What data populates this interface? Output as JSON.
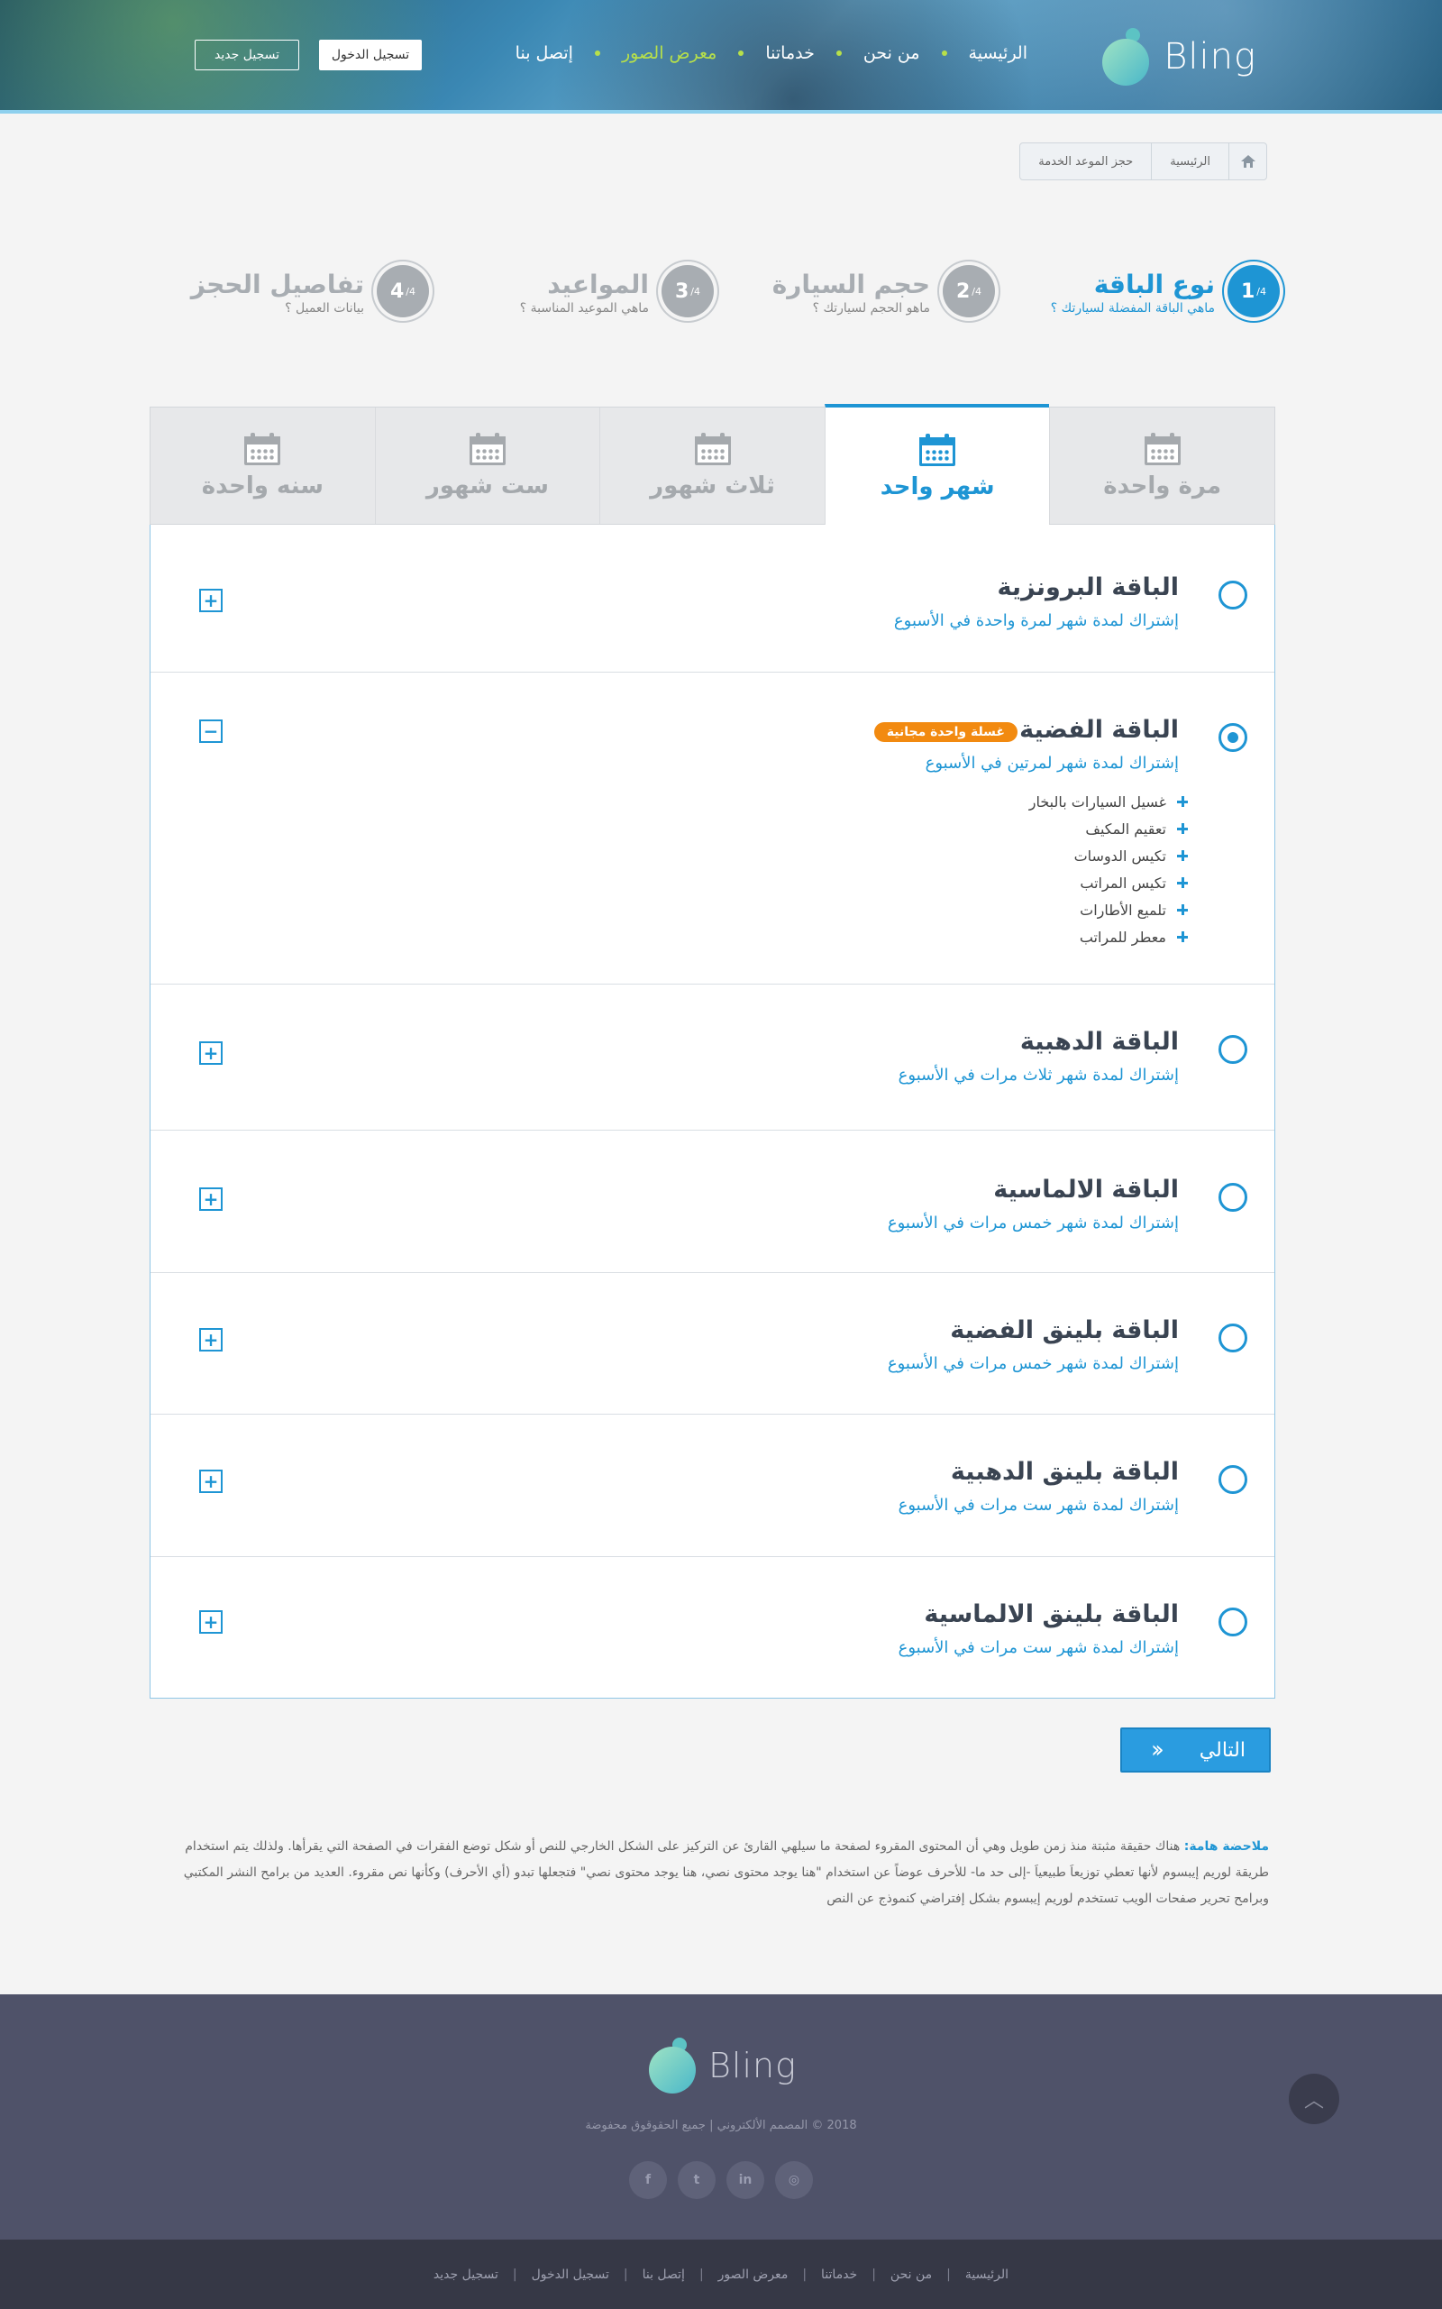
{
  "header": {
    "logo_text": "Bling",
    "nav": [
      {
        "label": "الرئيسية",
        "active": false
      },
      {
        "label": "من نحن",
        "active": false
      },
      {
        "label": "خدماتنا",
        "active": false
      },
      {
        "label": "معرض الصور",
        "active": true
      },
      {
        "label": "إتصل بنا",
        "active": false
      }
    ],
    "login_label": "تسجيل الدخول",
    "register_label": "تسجيل جديد"
  },
  "breadcrumb": {
    "home_icon": "home-icon",
    "items": [
      "الرئيسية",
      "حجز الموعد الخدمة"
    ]
  },
  "steps": [
    {
      "number": "1",
      "total": "/4",
      "title": "نوع الباقة",
      "subtitle": "ماهي الباقة المفضلة لسيارتك ؟",
      "active": true
    },
    {
      "number": "2",
      "total": "/4",
      "title": "حجم السيارة",
      "subtitle": "ماهو الحجم لسيارتك ؟",
      "active": false
    },
    {
      "number": "3",
      "total": "/4",
      "title": "المواعيد",
      "subtitle": "ماهي الموعيد المناسبة ؟",
      "active": false
    },
    {
      "number": "4",
      "total": "/4",
      "title": "تفاصيل الحجز",
      "subtitle": "بيانات العميل ؟",
      "active": false
    }
  ],
  "tabs": [
    {
      "label": "مرة واحدة",
      "icon": "calendar-icon",
      "active": false
    },
    {
      "label": "شهر واحد",
      "icon": "calendar-icon",
      "active": true
    },
    {
      "label": "ثلاث شهور",
      "icon": "calendar-icon",
      "active": false
    },
    {
      "label": "ست شهور",
      "icon": "calendar-icon",
      "active": false
    },
    {
      "label": "سنه واحدة",
      "icon": "calendar-icon",
      "active": false
    }
  ],
  "packages": [
    {
      "title": "الباقة البرونزية",
      "subtitle": "إشتراك لمدة شهر لمرة واحدة في الأسبوع",
      "selected": false,
      "expanded": false
    },
    {
      "title": "الباقة الفضية",
      "subtitle": "إشتراك لمدة شهر لمرتين في الأسبوع",
      "selected": true,
      "expanded": true,
      "badge": "غسلة واحدة مجانية",
      "features": [
        "غسيل السيارات بالبخار",
        "تعقيم المكيف",
        "تكيس الدوسات",
        "تكيس المراتب",
        "تلميع الأطارات",
        "معطر للمراتب"
      ]
    },
    {
      "title": "الباقة الدهبية",
      "subtitle": "إشتراك لمدة شهر ثلاث مرات في الأسبوع",
      "selected": false,
      "expanded": false
    },
    {
      "title": "الباقة الالماسية",
      "subtitle": "إشتراك لمدة شهر خمس مرات في الأسبوع",
      "selected": false,
      "expanded": false
    },
    {
      "title": "الباقة بلينق الفضية",
      "subtitle": "إشتراك لمدة شهر خمس مرات في الأسبوع",
      "selected": false,
      "expanded": false
    },
    {
      "title": "الباقة بلينق الدهبية",
      "subtitle": "إشتراك لمدة شهر ست مرات في الأسبوع",
      "selected": false,
      "expanded": false
    },
    {
      "title": "الباقة بلينق الالماسية",
      "subtitle": "إشتراك لمدة شهر ست مرات في الأسبوع",
      "selected": false,
      "expanded": false
    }
  ],
  "next_button": {
    "label": "التالي",
    "icon": "double-chevron-left-icon"
  },
  "note": {
    "label": "ملاحضة هامة:",
    "text": "هناك حقيقة مثبتة منذ زمن طويل وهي أن المحتوى المقروء لصفحة ما سيلهي القارئ عن التركيز على الشكل الخارجي للنص أو شكل توضع الفقرات في الصفحة التي يقرأها. ولذلك يتم استخدام طريقة لوريم إيبسوم لأنها تعطي توزيعاَ طبيعياَ -إلى حد ما- للأحرف عوضاً عن استخدام \"هنا يوجد محتوى نصي، هنا يوجد محتوى نصي\" فتجعلها تبدو (أي الأحرف) وكأنها نص مقروء. العديد من برامح النشر المكتبي وبرامح تحرير صفحات الويب تستخدم لوريم إيبسوم بشكل إفتراضي كنموذج عن النص"
  },
  "footer": {
    "logo_text": "Bling",
    "copyright": "2018 © المصمم الألكتروني | جميع الحقوقوق محفوضة",
    "socials": [
      {
        "icon": "instagram-icon",
        "glyph": "◎"
      },
      {
        "icon": "linkedin-icon",
        "glyph": "in"
      },
      {
        "icon": "twitter-icon",
        "glyph": "t"
      },
      {
        "icon": "facebook-icon",
        "glyph": "f"
      }
    ],
    "to_top_icon": "chevron-up-icon",
    "links": [
      "الرئيسية",
      "من نحن",
      "خدماتنا",
      "معرض الصور",
      "إتصل بنا",
      "تسجيل الدخول",
      "تسجيل جديد"
    ]
  }
}
